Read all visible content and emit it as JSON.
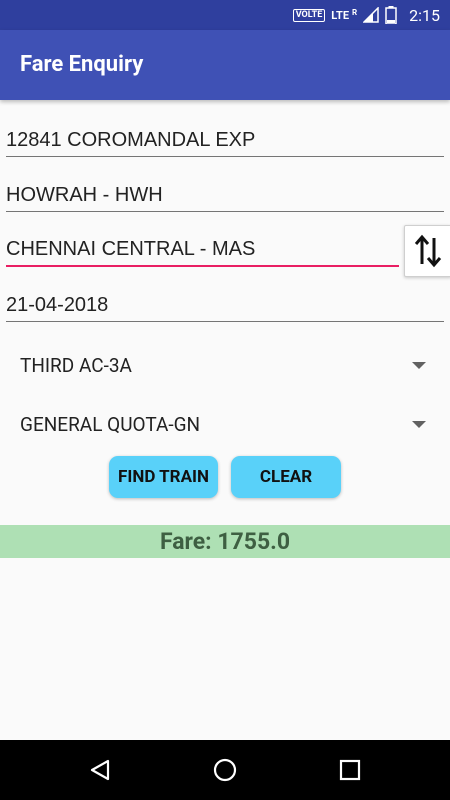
{
  "status_bar": {
    "volte": "VOLTE",
    "network": "LTE",
    "roaming": "R",
    "time": "2:15"
  },
  "app_bar": {
    "title": "Fare Enquiry"
  },
  "form": {
    "train_value": "12841 COROMANDAL EXP",
    "from_value": "HOWRAH - HWH",
    "to_value": "CHENNAI CENTRAL - MAS",
    "date_value": "21-04-2018",
    "class_selected": "THIRD AC-3A",
    "quota_selected": "GENERAL QUOTA-GN",
    "find_label": "FIND TRAIN",
    "clear_label": "CLEAR"
  },
  "result": {
    "fare_text": "Fare: 1755.0"
  },
  "colors": {
    "app_bar": "#3f51b5",
    "status_bar": "#2f3f9e",
    "accent": "#e91e63",
    "button": "#59d1f9",
    "fare_bg": "#aee0b4",
    "fare_text": "#3e5f42"
  },
  "icons": {
    "swap": "swap-vertical-icon",
    "signal": "signal-icon",
    "battery": "battery-icon",
    "back": "back-icon",
    "home": "home-icon",
    "recents": "recents-icon"
  }
}
